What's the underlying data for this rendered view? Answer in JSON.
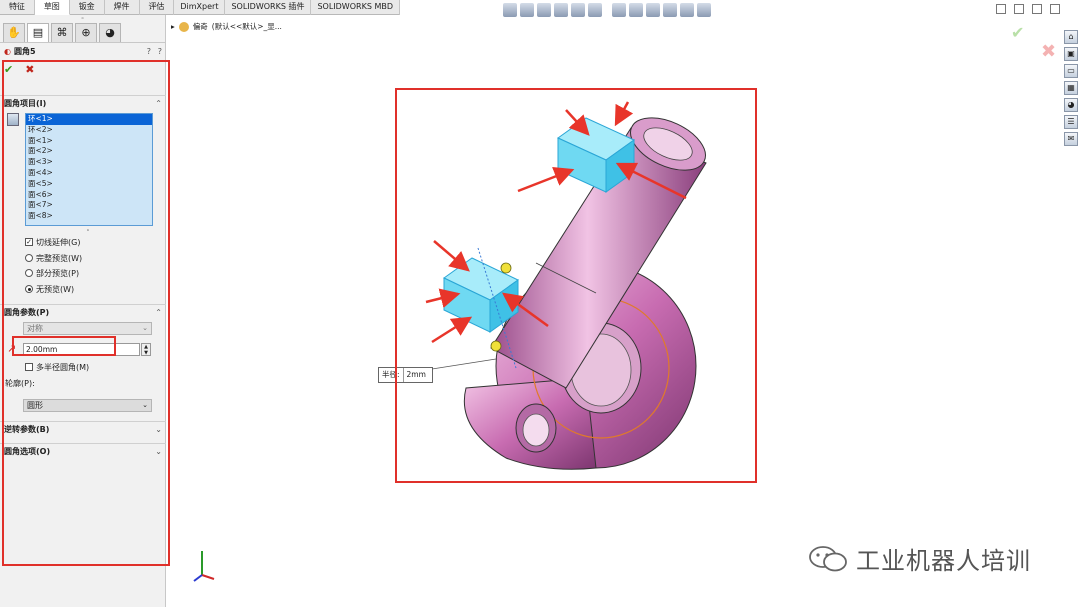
{
  "tabs": [
    {
      "label": "特征"
    },
    {
      "label": "草图"
    },
    {
      "label": "钣金"
    },
    {
      "label": "焊件"
    },
    {
      "label": "评估"
    },
    {
      "label": "DimXpert"
    },
    {
      "label": "SOLIDWORKS 插件"
    },
    {
      "label": "SOLIDWORKS MBD"
    }
  ],
  "active_tab": "草图",
  "property_manager": {
    "title": "圆角5",
    "help_icons": [
      "?",
      "?"
    ],
    "fillet_items": {
      "header": "圆角项目(I)",
      "items": [
        "环<1>",
        "环<2>",
        "面<1>",
        "面<2>",
        "面<3>",
        "面<4>",
        "面<5>",
        "面<6>",
        "面<7>",
        "面<8>"
      ],
      "selected_index": 0,
      "tangent_propagation": {
        "label": "切线延伸(G)",
        "checked": true
      },
      "preview_options": [
        {
          "label": "完整预览(W)",
          "selected": false
        },
        {
          "label": "部分预览(P)",
          "selected": false
        },
        {
          "label": "无预览(W)",
          "selected": true
        }
      ]
    },
    "fillet_params": {
      "header": "圆角参数(P)",
      "method": "对称",
      "radius": "2.00mm",
      "multi_radius": {
        "label": "多半径圆角(M)",
        "checked": false
      },
      "profile_label": "轮廓(P):",
      "profile": "圆形"
    },
    "setback_header": "逆转参数(B)",
    "options_header": "圆角选项(O)"
  },
  "breadcrumb": {
    "part_name": "偏奇",
    "config": "(默认<<默认>_显..."
  },
  "callout": {
    "label": "半径:",
    "value": "2mm"
  },
  "watermark": "工业机器人培训",
  "colors": {
    "accent_red": "#e0302a",
    "selection_blue": "#0a64d6",
    "model_pink": "#c86cb1",
    "highlight_cyan": "#6fd9f2"
  }
}
